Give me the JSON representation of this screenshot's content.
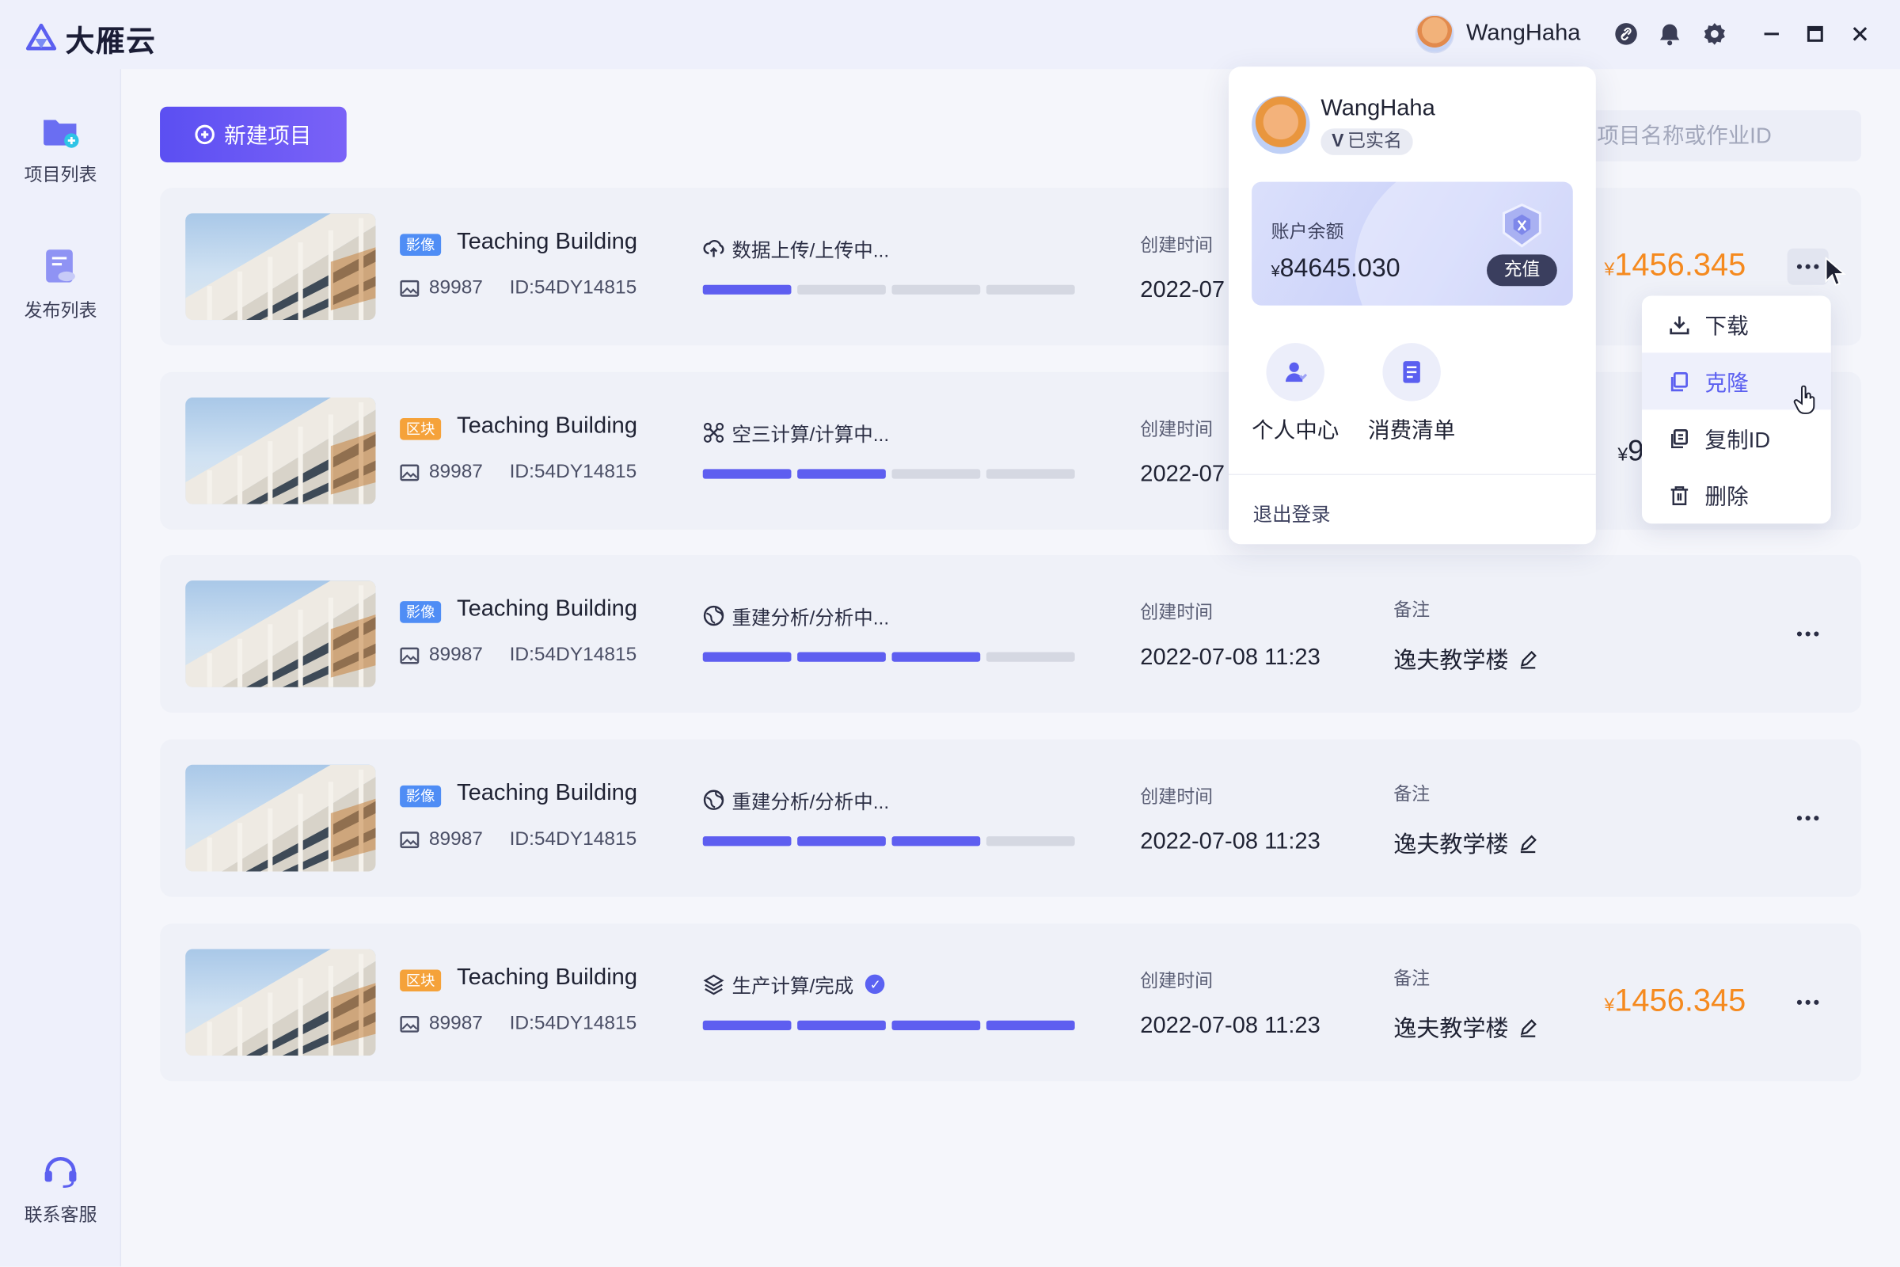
{
  "app": {
    "brand": "大雁云"
  },
  "titlebar": {
    "username": "WangHaha"
  },
  "sidebar": {
    "items": [
      {
        "label": "项目列表",
        "icon": "folder-plus-icon"
      },
      {
        "label": "发布列表",
        "icon": "publish-doc-icon"
      }
    ],
    "support": {
      "label": "联系客服",
      "icon": "headset-icon"
    }
  },
  "toolbar": {
    "new_project": "新建项目",
    "search_placeholder": "项目名称或作业ID"
  },
  "labels": {
    "created": "创建时间",
    "remark": "备注"
  },
  "rows": [
    {
      "tag": "影像",
      "tag_type": "img",
      "title": "Teaching Building",
      "count": "89987",
      "id": "ID:54DY14815",
      "status": "数据上传/上传中...",
      "status_icon": "cloud-upload-icon",
      "progress": 1,
      "created": "2022-07",
      "remark": "",
      "price_yen": "¥",
      "price": "1456.345"
    },
    {
      "tag": "区块",
      "tag_type": "blk",
      "title": "Teaching Building",
      "count": "89987",
      "id": "ID:54DY14815",
      "status": "空三计算/计算中...",
      "status_icon": "drone-icon",
      "progress": 2,
      "created": "2022-07",
      "remark": "",
      "price_yen": "¥",
      "price": "9"
    },
    {
      "tag": "影像",
      "tag_type": "img",
      "title": "Teaching Building",
      "count": "89987",
      "id": "ID:54DY14815",
      "status": "重建分析/分析中...",
      "status_icon": "globe-icon",
      "progress": 3,
      "created": "2022-07-08 11:23",
      "remark": "逸夫教学楼",
      "price_yen": "",
      "price": ""
    },
    {
      "tag": "影像",
      "tag_type": "img",
      "title": "Teaching Building",
      "count": "89987",
      "id": "ID:54DY14815",
      "status": "重建分析/分析中...",
      "status_icon": "globe-icon",
      "progress": 3,
      "created": "2022-07-08 11:23",
      "remark": "逸夫教学楼",
      "price_yen": "",
      "price": ""
    },
    {
      "tag": "区块",
      "tag_type": "blk",
      "title": "Teaching Building",
      "count": "89987",
      "id": "ID:54DY14815",
      "status": "生产计算/完成",
      "status_icon": "layers-icon",
      "progress": 4,
      "created": "2022-07-08 11:23",
      "remark": "逸夫教学楼",
      "price_yen": "¥",
      "price": "1456.345"
    }
  ],
  "popover": {
    "name": "WangHaha",
    "verified_mark": "V",
    "verified": "已实名",
    "balance_label": "账户余额",
    "balance_yen": "¥",
    "balance": "84645.030",
    "topup": "充值",
    "actions": [
      {
        "label": "个人中心"
      },
      {
        "label": "消费清单"
      }
    ],
    "logout": "退出登录"
  },
  "row_menu": {
    "items": [
      {
        "label": "下载"
      },
      {
        "label": "克隆"
      },
      {
        "label": "复制ID"
      },
      {
        "label": "删除"
      }
    ],
    "hovered": 1
  },
  "colors": {
    "accent": "#5e5ef0",
    "price": "#f58a1f",
    "tag_img": "#4f8df5",
    "tag_blk": "#f5a23a"
  }
}
